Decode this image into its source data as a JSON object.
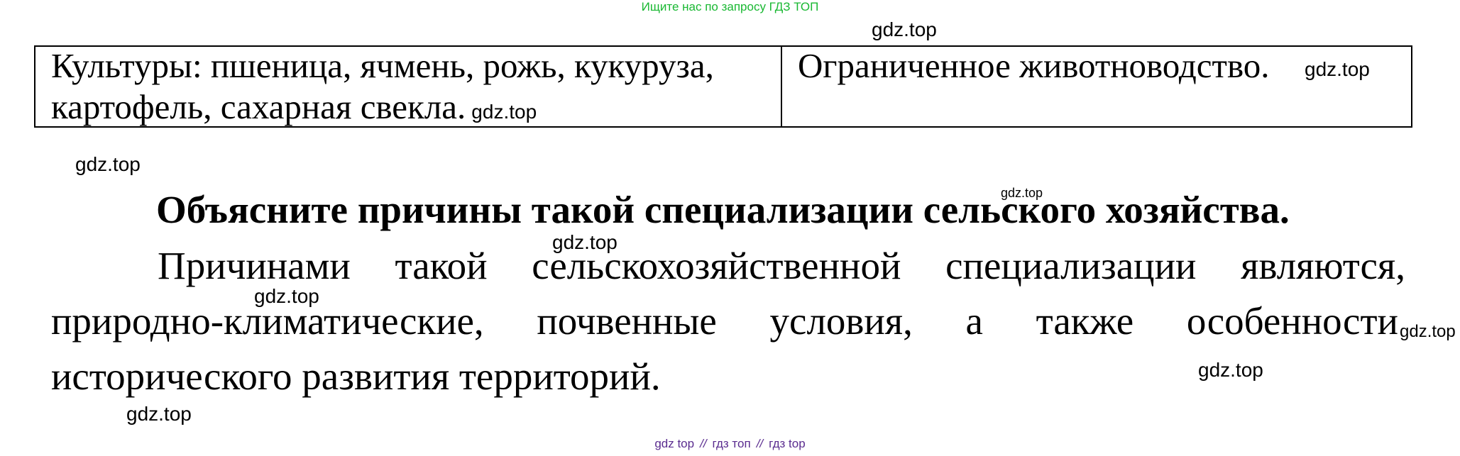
{
  "banner": {
    "text": "Ищите нас по запросу ГДЗ ТОП",
    "color": "#19b832"
  },
  "watermark": "gdz.top",
  "table": {
    "left_line1": "Культуры: пшеница, ячмень, рожь, кукуруза,",
    "left_line2": "картофель, сахарная свекла.",
    "right_line1": "Ограниченное животноводство."
  },
  "question": "Объясните причины такой специализации сельского хозяйства.",
  "answer": {
    "line1_words": [
      "Причинами",
      "такой",
      "сельскохозяйственной",
      "специализации",
      "являются,"
    ],
    "line2_words": [
      "природно-климатические,",
      "почвенные",
      "условия,",
      "а",
      "также",
      "особенности"
    ],
    "line3": "исторического развития территорий."
  },
  "footer": {
    "part1": "gdz top",
    "separator": "//",
    "part2": "гдз топ",
    "part3": "гдз top",
    "color": "#5a2c8f"
  }
}
